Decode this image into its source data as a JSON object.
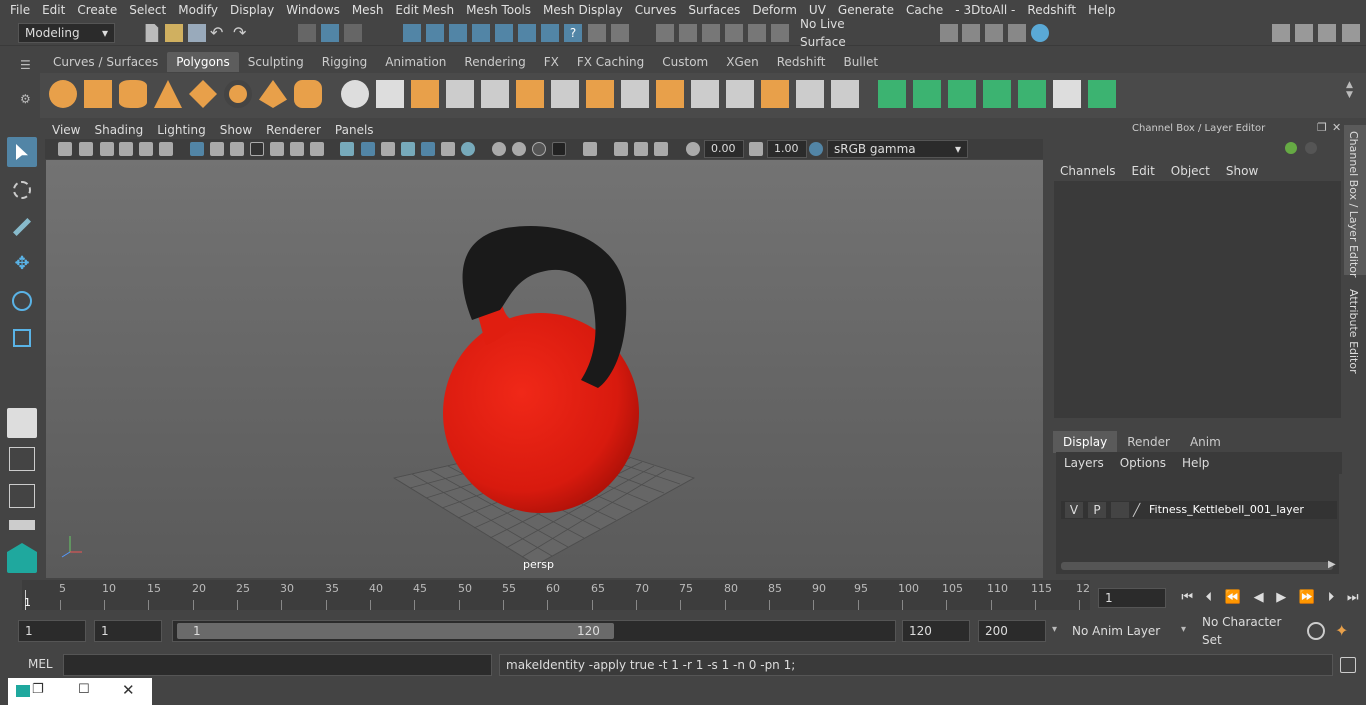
{
  "menubar": {
    "items": [
      "File",
      "Edit",
      "Create",
      "Select",
      "Modify",
      "Display",
      "Windows",
      "Mesh",
      "Edit Mesh",
      "Mesh Tools",
      "Mesh Display",
      "Curves",
      "Surfaces",
      "Deform",
      "UV",
      "Generate",
      "Cache",
      "- 3DtoAll -",
      "Redshift",
      "Help"
    ]
  },
  "status": {
    "mode": "Modeling",
    "live_surface": "No Live Surface"
  },
  "shelf": {
    "tabs": [
      "Curves / Surfaces",
      "Polygons",
      "Sculpting",
      "Rigging",
      "Animation",
      "Rendering",
      "FX",
      "FX Caching",
      "Custom",
      "XGen",
      "Redshift",
      "Bullet"
    ],
    "active": "Polygons"
  },
  "viewport": {
    "menu": [
      "View",
      "Shading",
      "Lighting",
      "Show",
      "Renderer",
      "Panels"
    ],
    "exposure": "0.00",
    "gamma": "1.00",
    "colorspace": "sRGB gamma",
    "camera_label": "persp"
  },
  "channelbox": {
    "title": "Channel Box / Layer Editor",
    "menu": [
      "Channels",
      "Edit",
      "Object",
      "Show"
    ]
  },
  "layereditor": {
    "tabs": [
      "Display",
      "Render",
      "Anim"
    ],
    "active": "Display",
    "menu": [
      "Layers",
      "Options",
      "Help"
    ],
    "layer": {
      "v": "V",
      "p": "P",
      "name": "Fitness_Kettlebell_001_layer"
    }
  },
  "side_tabs": {
    "channel": "Channel Box / Layer Editor",
    "attribute": "Attribute Editor"
  },
  "timeline": {
    "labels": [
      "5",
      "10",
      "15",
      "20",
      "25",
      "30",
      "35",
      "40",
      "45",
      "50",
      "55",
      "60",
      "65",
      "70",
      "75",
      "80",
      "85",
      "90",
      "95",
      "100",
      "105",
      "110",
      "115",
      "12"
    ],
    "current_frame": "1",
    "start_marker": "1"
  },
  "range": {
    "start": "1",
    "anim_start": "1",
    "slider_start": "1",
    "slider_end": "120",
    "end": "120",
    "anim_end": "200",
    "anim_layer": "No Anim Layer",
    "char_set": "No Character Set"
  },
  "cmd": {
    "label": "MEL",
    "result": "makeIdentity -apply true -t 1 -r 1 -s 1 -n 0 -pn 1;"
  },
  "colors": {
    "accent": "#5285a6",
    "kettle_red": "#e01e10",
    "handle": "#1a1a1a"
  }
}
